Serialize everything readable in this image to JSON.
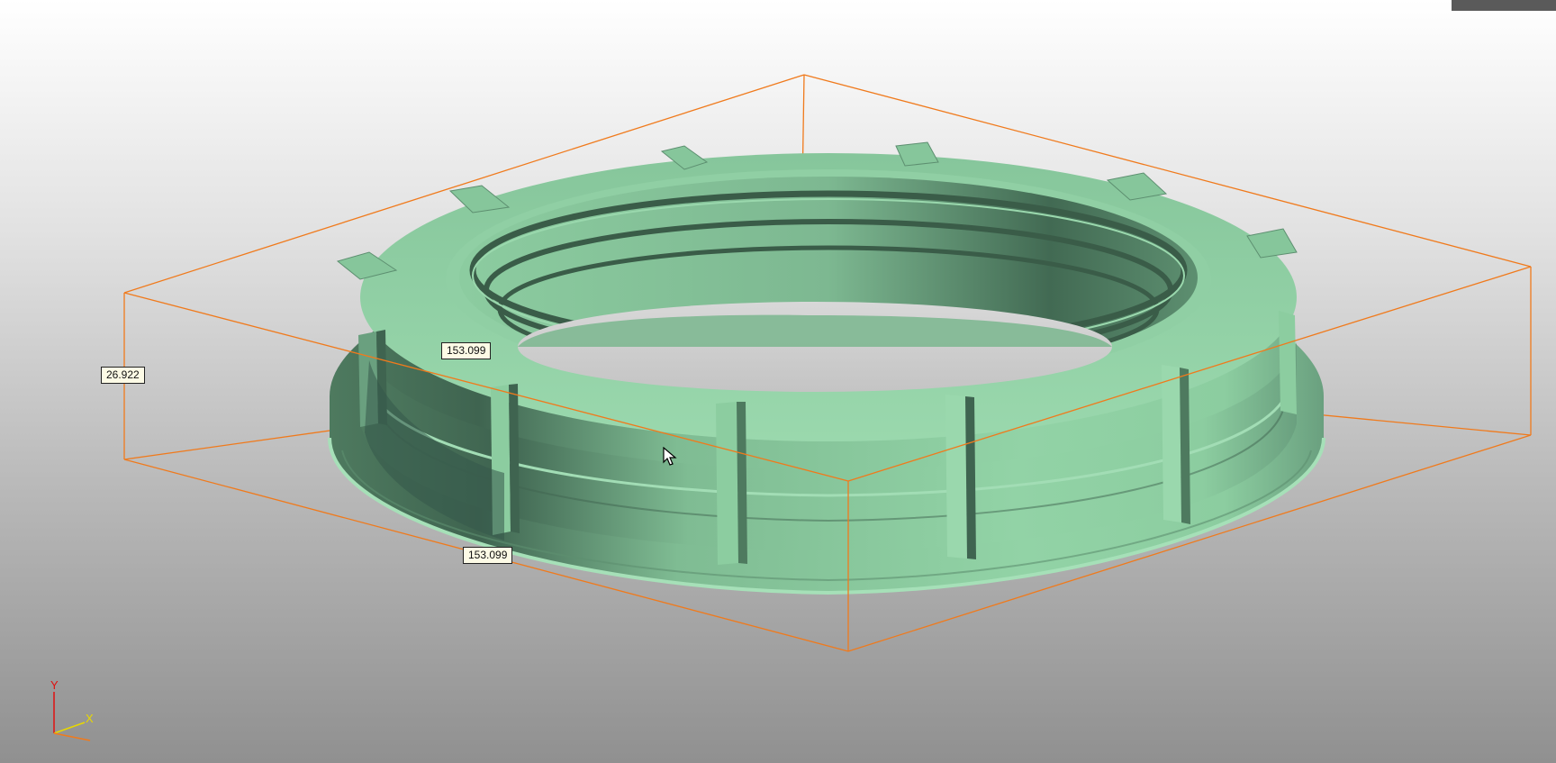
{
  "viewport": {
    "background_top": "#ffffff",
    "background_bottom": "#909090",
    "model_color": "#8fd1a3",
    "bbox_color": "#f07a1c"
  },
  "dimensions": {
    "height": "26.922",
    "width": "153.099",
    "depth": "153.099"
  },
  "axis": {
    "y_label": "Y",
    "x_label": "X",
    "y_color": "#e01010",
    "x_color": "#e8d800",
    "z_color": "#f07a1c"
  },
  "icons": {
    "cursor": "arrow-cursor-icon",
    "axis": "axis-triad-icon"
  }
}
